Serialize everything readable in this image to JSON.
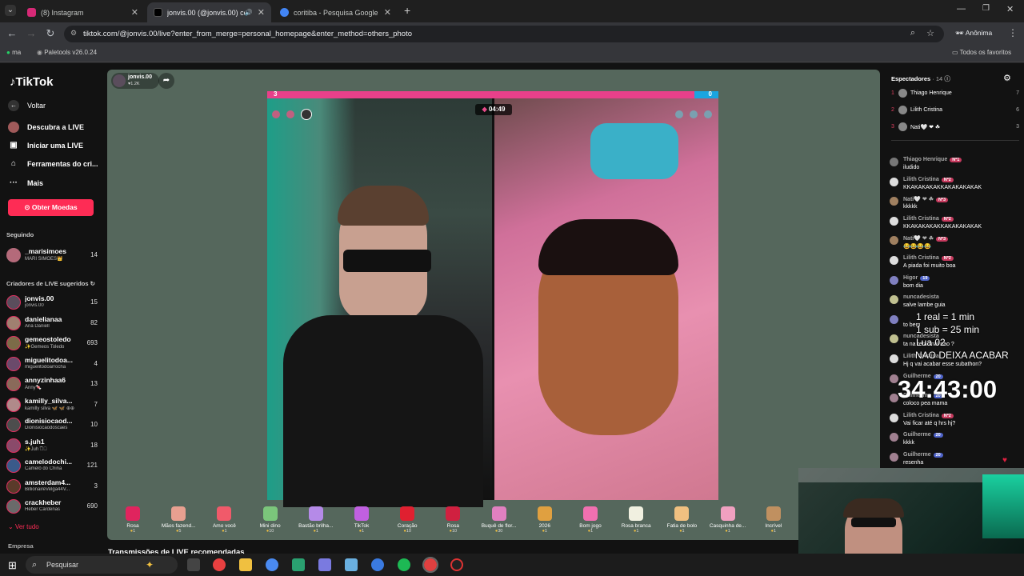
{
  "tabs": [
    {
      "title": "(8) Instagram",
      "color": "#d62976",
      "active": false
    },
    {
      "title": "jonvis.00 (@jonvis.00) com",
      "color": "#111",
      "active": true
    },
    {
      "title": "coritiba - Pesquisa Google",
      "color": "#4285f4",
      "active": false
    }
  ],
  "address": {
    "url": "tiktok.com/@jonvis.00/live?enter_from_merge=personal_homepage&enter_method=others_photo",
    "profile": "Anônima"
  },
  "bookmarks": {
    "item1": "ma",
    "item2": "Paletools v26.0.24",
    "all": "Todos os favoritos"
  },
  "nav": {
    "logo": "TikTok",
    "back": "Voltar",
    "discover": "Descubra a LIVE",
    "start": "Iniciar uma LIVE",
    "tools": "Ferramentas do cri...",
    "more": "Mais",
    "coins": "Obter Moedas",
    "following": "Seguindo",
    "suggested": "Criadores de LIVE sugeridos",
    "see_all": "Ver tudo",
    "company": "Empresa"
  },
  "following": [
    {
      "name": "_marisimoes",
      "sub": "MARI SIMÕES👑",
      "count": "14",
      "color": "#b46a7a"
    }
  ],
  "creators": [
    {
      "name": "jonvis.00",
      "sub": "jonvis.00",
      "count": "15",
      "color": "#5a4d5c"
    },
    {
      "name": "danielianaa",
      "sub": "Ana Daniell",
      "count": "82",
      "color": "#a08070"
    },
    {
      "name": "gemeostoledo",
      "sub": "✨Gemeos Toledo",
      "count": "693",
      "color": "#7c6b48"
    },
    {
      "name": "miguelitodoa...",
      "sub": "miguelitodoarrocha",
      "count": "4",
      "color": "#6b4a6b"
    },
    {
      "name": "annyzinhaa6",
      "sub": "Anny🍬",
      "count": "13",
      "color": "#8a6a5a"
    },
    {
      "name": "kamilly_silva...",
      "sub": "kamilly silva 🦋 🦋 ⊕⊕",
      "count": "7",
      "color": "#b08a8a"
    },
    {
      "name": "dionisiocaod...",
      "sub": "Dionisiocaodoscaes",
      "count": "10",
      "color": "#4d4d4d"
    },
    {
      "name": "s.juh1",
      "sub": "✨Juh ͡𖥔⃟",
      "count": "18",
      "color": "#8a4a6a"
    },
    {
      "name": "camelodochi...",
      "sub": "Camelô do China",
      "count": "121",
      "color": "#3a5a8a"
    },
    {
      "name": "amsterdam4...",
      "sub": "BillionaireVelga44V...",
      "count": "3",
      "color": "#5a3a2a"
    },
    {
      "name": "crackheber",
      "sub": "Heber Cardenas",
      "count": "690",
      "color": "#6a6a6a"
    }
  ],
  "host": {
    "name": "jonvis.00",
    "likes": "♥1.2K"
  },
  "battle": {
    "left_score": "3",
    "right_score": "0",
    "timer": "04:49"
  },
  "gifts": [
    {
      "name": "Rosa",
      "price": "1",
      "color": "#e0245e"
    },
    {
      "name": "Mãos fazend...",
      "price": "5",
      "color": "#e8a090"
    },
    {
      "name": "Amo você",
      "price": "1",
      "color": "#f05a6a"
    },
    {
      "name": "Mini dino",
      "price": "10",
      "color": "#7bc67b"
    },
    {
      "name": "Bastão brilha...",
      "price": "1",
      "color": "#b58ae8"
    },
    {
      "name": "TikTok",
      "price": "1",
      "color": "#c060e0"
    },
    {
      "name": "Coração",
      "price": "10",
      "color": "#e02030"
    },
    {
      "name": "Rosa",
      "price": "10",
      "color": "#d02040"
    },
    {
      "name": "Buquê de flor...",
      "price": "30",
      "color": "#e080c0"
    },
    {
      "name": "2026",
      "price": "1",
      "color": "#e0a040"
    },
    {
      "name": "Bom jogo",
      "price": "1",
      "color": "#f070b0"
    },
    {
      "name": "Rosa branca",
      "price": "1",
      "color": "#f0f0e0"
    },
    {
      "name": "Fatia de bolo",
      "price": "1",
      "color": "#f0c080"
    },
    {
      "name": "Casquinha de...",
      "price": "1",
      "color": "#f0a0c0"
    },
    {
      "name": "Incrível",
      "price": "1",
      "color": "#c09060"
    }
  ],
  "recommended": "Transmissões de LIVE recomendadas",
  "viewers": {
    "label": "Espectadores",
    "count": "· 14",
    "list": [
      {
        "rank": "1",
        "name": "Thiago Henrique",
        "score": "7"
      },
      {
        "rank": "2",
        "name": "Lilith Cristina",
        "score": "6"
      },
      {
        "rank": "3",
        "name": "Nati🤍 ❤ ☘",
        "score": "3"
      }
    ]
  },
  "chat": [
    {
      "user": "Thiago Henrique",
      "badge": "Nº1",
      "text": "iludido",
      "color": "#777"
    },
    {
      "user": "Lilith Cristina",
      "badge": "Nº2",
      "text": "KKAKAKAKAKKAKAKAKAKAK",
      "color": "#ddd"
    },
    {
      "user": "Nati🤍 ❤ ☘",
      "badge": "Nº3",
      "text": "kkkkk",
      "color": "#a08060"
    },
    {
      "user": "Lilith Cristina",
      "badge": "Nº2",
      "text": "KKAKAKAKAKKAKAKAKAKAK",
      "color": "#ddd"
    },
    {
      "user": "Nati🤍 ❤ ☘",
      "badge": "Nº3",
      "text": "😂😂😂😂",
      "color": "#a08060"
    },
    {
      "user": "Lilith Cristina",
      "badge": "Nº2",
      "text": "A piada foi muito boa",
      "color": "#ddd"
    },
    {
      "user": "Higor",
      "badge": "19",
      "text": "bom dia",
      "color": "#8080c0"
    },
    {
      "user": "nuncadesista",
      "badge": "",
      "text": "salve lambe guia",
      "color": "#c0c090"
    },
    {
      "user": "",
      "badge": "",
      "text": "to bem",
      "color": "#8080c0"
    },
    {
      "user": "nuncadesista",
      "badge": "",
      "text": "ta na reta final nao ?",
      "color": "#c0c090"
    },
    {
      "user": "Lilith Cristina",
      "badge": "",
      "text": "Hj q vai acabar esse subathon?",
      "color": "#ddd"
    },
    {
      "user": "Guilherme",
      "badge": "20",
      "text": "",
      "color": "#a08090"
    },
    {
      "user": "Guilherme",
      "badge": "20",
      "text": "coloco pea mama",
      "color": "#a08090"
    },
    {
      "user": "Lilith Cristina",
      "badge": "Nº2",
      "text": "Vai ficar até q hrs hj?",
      "color": "#ddd"
    },
    {
      "user": "Guilherme",
      "badge": "20",
      "text": "kkkk",
      "color": "#a08090"
    },
    {
      "user": "Guilherme",
      "badge": "20",
      "text": "resenha",
      "color": "#a08090"
    }
  ],
  "overlay": {
    "line1": "1 real = 1 min",
    "line2": "1 sub = 25 min",
    "line3": "Lua 02",
    "line4": "NAO DEIXA ACABAR",
    "timer": "34:43:00"
  },
  "taskbar": {
    "search": "Pesquisar"
  }
}
